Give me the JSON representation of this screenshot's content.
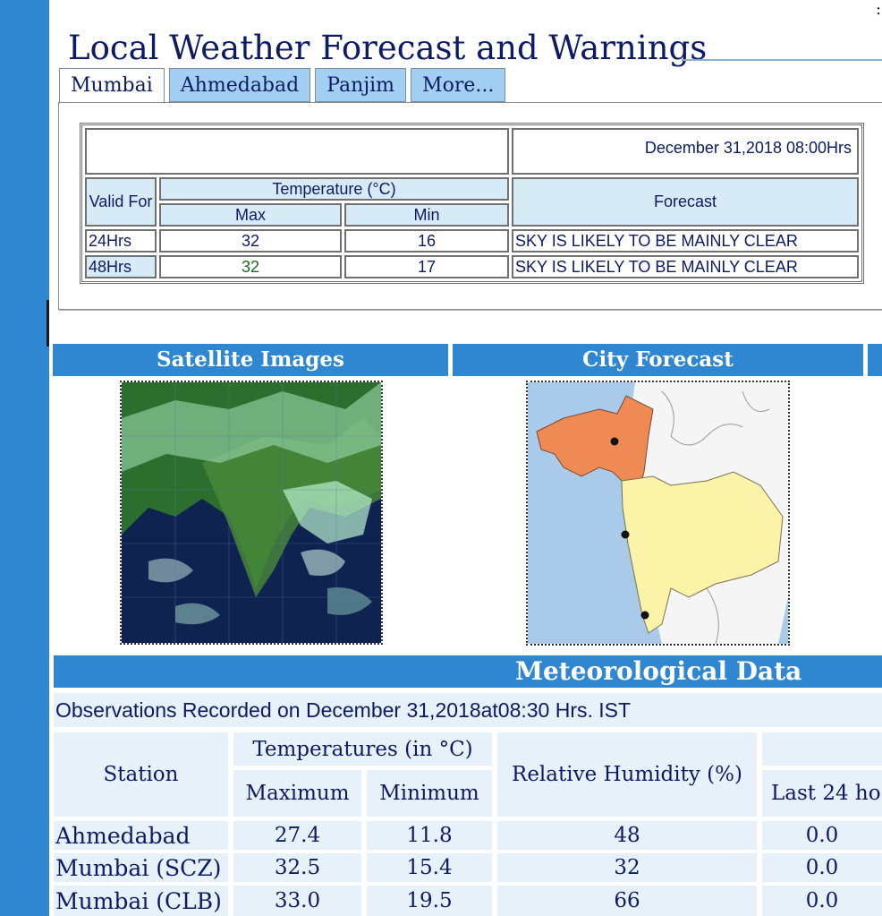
{
  "page_title": "Local Weather Forecast and Warnings",
  "tabs": [
    "Mumbai",
    "Ahmedabad",
    "Panjim",
    "More..."
  ],
  "forecast": {
    "issued": "December 31,2018 08:00Hrs",
    "valid_for_label": "Valid For",
    "temperature_label": "Temperature (°C)",
    "max_label": "Max",
    "min_label": "Min",
    "forecast_label": "Forecast",
    "rows": [
      {
        "valid": "24Hrs",
        "max": "32",
        "min": "16",
        "text": "SKY IS LIKELY TO BE MAINLY CLEAR"
      },
      {
        "valid": "48Hrs",
        "max": "32",
        "min": "17",
        "text": "SKY IS LIKELY TO BE MAINLY CLEAR"
      }
    ]
  },
  "sections": {
    "satellite": "Satellite Images",
    "city_forecast": "City Forecast"
  },
  "met": {
    "title": "Meteorological Data",
    "observations": "Observations Recorded on December 31,2018at08:30 Hrs. IST",
    "station_label": "Station",
    "temps_label": "Temperatures (in °C)",
    "maximum_label": "Maximum",
    "minimum_label": "Minimum",
    "rh_label": "Relative Humidity (%)",
    "last24_label": "Last 24 ho",
    "rows": [
      {
        "station": "Ahmedabad",
        "max": "27.4",
        "min": "11.8",
        "rh": "48",
        "rain": "0.0"
      },
      {
        "station": "Mumbai (SCZ)",
        "max": "32.5",
        "min": "15.4",
        "rh": "32",
        "rain": "0.0"
      },
      {
        "station": "Mumbai (CLB)",
        "max": "33.0",
        "min": "19.5",
        "rh": "66",
        "rain": "0.0"
      }
    ]
  },
  "colors": {
    "accent_blue": "#2f87d1",
    "tab_blue": "#a3d0f2",
    "navy_text": "#0d1a66",
    "light_cell": "#e6f1fa"
  }
}
